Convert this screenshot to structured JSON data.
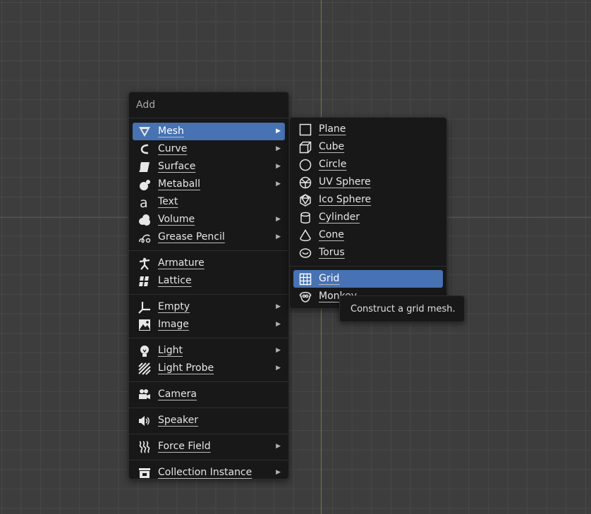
{
  "add_menu": {
    "title": "Add",
    "groups": [
      [
        {
          "label": "Mesh",
          "icon": "mesh-icon",
          "submenu": true,
          "active": true
        },
        {
          "label": "Curve",
          "icon": "curve-icon",
          "submenu": true
        },
        {
          "label": "Surface",
          "icon": "surface-icon",
          "submenu": true
        },
        {
          "label": "Metaball",
          "icon": "metaball-icon",
          "submenu": true
        },
        {
          "label": "Text",
          "icon": "text-icon",
          "submenu": false
        },
        {
          "label": "Volume",
          "icon": "volume-icon",
          "submenu": true
        },
        {
          "label": "Grease Pencil",
          "icon": "grease-pencil-icon",
          "submenu": true
        }
      ],
      [
        {
          "label": "Armature",
          "icon": "armature-icon",
          "submenu": false
        },
        {
          "label": "Lattice",
          "icon": "lattice-icon",
          "submenu": false
        }
      ],
      [
        {
          "label": "Empty",
          "icon": "empty-icon",
          "submenu": true
        },
        {
          "label": "Image",
          "icon": "image-icon",
          "submenu": true
        }
      ],
      [
        {
          "label": "Light",
          "icon": "light-icon",
          "submenu": true
        },
        {
          "label": "Light Probe",
          "icon": "light-probe-icon",
          "submenu": true
        }
      ],
      [
        {
          "label": "Camera",
          "icon": "camera-icon",
          "submenu": false
        }
      ],
      [
        {
          "label": "Speaker",
          "icon": "speaker-icon",
          "submenu": false
        }
      ],
      [
        {
          "label": "Force Field",
          "icon": "force-field-icon",
          "submenu": true
        }
      ],
      [
        {
          "label": "Collection Instance",
          "icon": "collection-instance-icon",
          "submenu": true
        }
      ]
    ]
  },
  "mesh_menu": {
    "groups": [
      [
        {
          "label": "Plane",
          "icon": "plane-icon"
        },
        {
          "label": "Cube",
          "icon": "cube-icon"
        },
        {
          "label": "Circle",
          "icon": "circle-icon"
        },
        {
          "label": "UV Sphere",
          "icon": "uv-sphere-icon"
        },
        {
          "label": "Ico Sphere",
          "icon": "ico-sphere-icon"
        },
        {
          "label": "Cylinder",
          "icon": "cylinder-icon"
        },
        {
          "label": "Cone",
          "icon": "cone-icon"
        },
        {
          "label": "Torus",
          "icon": "torus-icon"
        }
      ],
      [
        {
          "label": "Grid",
          "icon": "grid-icon",
          "active": true
        },
        {
          "label": "Monkey",
          "icon": "monkey-icon"
        }
      ]
    ]
  },
  "tooltip": {
    "text": "Construct a grid mesh."
  },
  "colors": {
    "active": "#4772b3",
    "menu_bg": "#181818",
    "viewport_bg": "#3d3d3d",
    "x_axis": "#8a3e48",
    "y_axis": "#6a8a2a"
  }
}
